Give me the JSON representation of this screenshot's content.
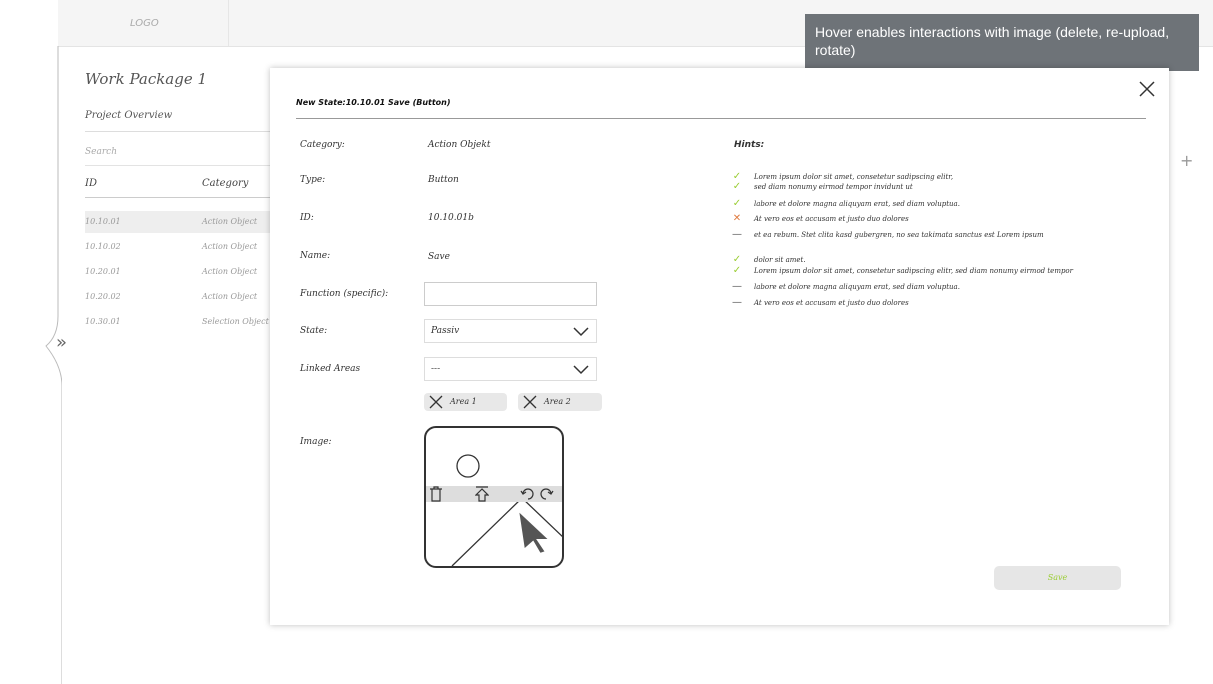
{
  "app": {
    "logo": "LOGO"
  },
  "tooltip": {
    "text": "Hover enables interactions with image (delete, re-upload, rotate)"
  },
  "background": {
    "title": "Work Package 1",
    "subtitle": "Project Overview",
    "search_placeholder": "Search",
    "columns": [
      "ID",
      "Category"
    ],
    "rows": [
      {
        "id": "10.10.01",
        "category": "Action Object",
        "selected": true
      },
      {
        "id": "10.10.02",
        "category": "Action Object",
        "selected": false
      },
      {
        "id": "10.20.01",
        "category": "Action Object",
        "selected": false
      },
      {
        "id": "10.20.02",
        "category": "Action Object",
        "selected": false
      },
      {
        "id": "10.30.01",
        "category": "Selection Object",
        "selected": false
      }
    ]
  },
  "modal": {
    "title": "New State:10.10.01 Save (Button)",
    "fields": {
      "category_label": "Category:",
      "category_value": "Action Objekt",
      "type_label": "Type:",
      "type_value": "Button",
      "id_label": "ID:",
      "id_value": "10.10.01b",
      "name_label": "Name:",
      "name_value": "Save",
      "function_label": "Function (specific):",
      "function_value": "",
      "state_label": "State:",
      "state_value": "Passiv",
      "linked_label": "Linked Areas",
      "linked_value": "---",
      "image_label": "Image:"
    },
    "chips": [
      "Area 1",
      "Area 2"
    ],
    "hints_title": "Hints:",
    "hints": [
      {
        "icon": "check",
        "text": "Lorem ipsum dolor sit amet, consetetur sadipscing elitr,"
      },
      {
        "icon": "check",
        "text": "sed diam nonumy eirmod tempor invidunt ut"
      },
      {
        "icon": "check",
        "text": "labore et dolore magna aliquyam erat, sed diam voluptua."
      },
      {
        "icon": "cross",
        "text": "At vero eos et accusam et justo duo dolores"
      },
      {
        "icon": "dash",
        "text": "et ea rebum. Stet clita kasd gubergren, no sea takimata sanctus est Lorem ipsum"
      },
      {
        "icon": "check",
        "text": "dolor sit amet."
      },
      {
        "icon": "check",
        "text": "Lorem ipsum dolor sit amet, consetetur sadipscing elitr, sed diam nonumy eirmod tempor"
      },
      {
        "icon": "dash",
        "text": "labore et dolore magna aliquyam erat, sed diam voluptua."
      },
      {
        "icon": "dash",
        "text": "At vero eos et accusam et justo duo dolores"
      }
    ],
    "save_label": "Save"
  },
  "colors": {
    "check": "#9acd32",
    "cross": "#e07a3f",
    "dash": "#555555",
    "tooltip_bg": "#6e7378"
  }
}
